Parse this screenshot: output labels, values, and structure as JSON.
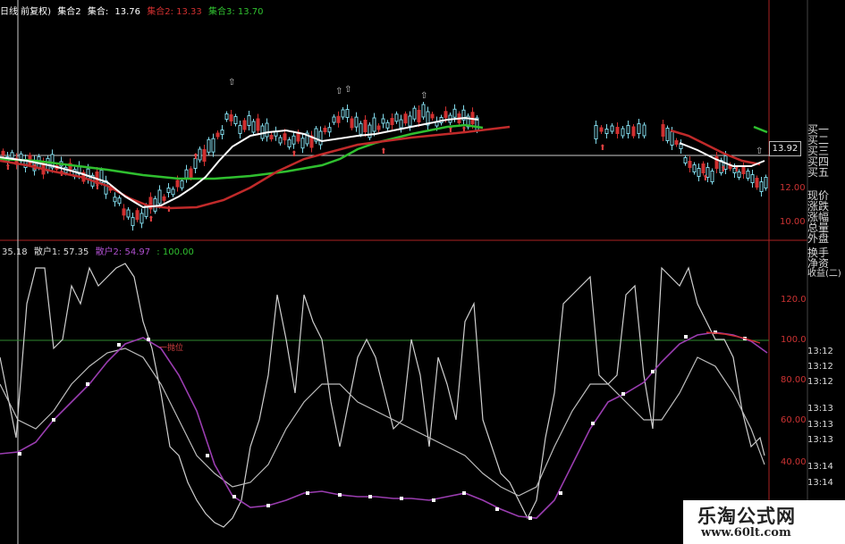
{
  "top_legend": {
    "label_period": "日线 前复权)",
    "label_set2": "集合2",
    "label_set": "集合:",
    "val_set": "13.76",
    "label_set2b": "集合2: 13.33",
    "label_set3": "集合3: 13.70",
    "colors": {
      "white": "#ffffff",
      "red": "#d03030",
      "green": "#30c030"
    }
  },
  "bottom_legend": {
    "left_value": "35.18",
    "line1": "散户1: 57.35",
    "line2": "散户2: 54.97",
    "line3": ": 100.00"
  },
  "side_panel": [
    "买一",
    "买二",
    "买三",
    "买四",
    "买五",
    "现价",
    "涨跌",
    "涨幅",
    "总量",
    "外盘",
    "换手",
    "净资",
    "收益(二)"
  ],
  "price_axis": [
    "12.00",
    "10.00"
  ],
  "price_box": "13.92",
  "osc_axis": [
    "120.0",
    "100.0",
    "80.00",
    "60.00",
    "40.00"
  ],
  "time_labels": [
    "13:12",
    "13:12",
    "13:12",
    "13:13",
    "13:13",
    "13:13",
    "13:14",
    "13:14"
  ],
  "annotations": {
    "dump": "一抛位"
  },
  "watermark": {
    "title": "乐淘公式网",
    "url": "www.60lt.com"
  }
}
